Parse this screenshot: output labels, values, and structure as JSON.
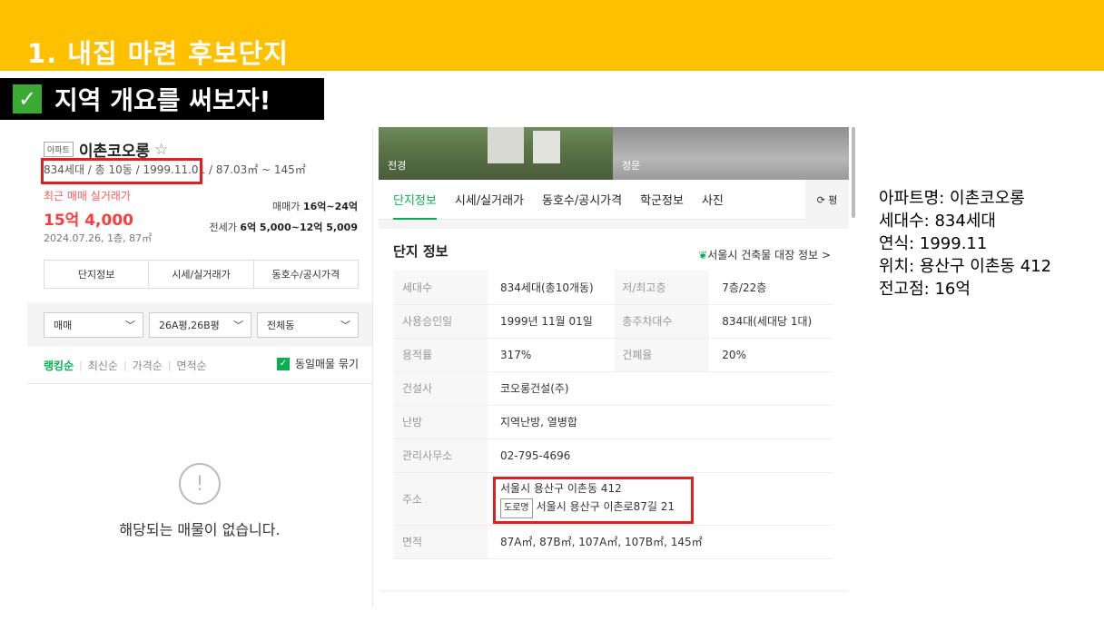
{
  "banner": {
    "title": "1. 내집 마련 후보단지"
  },
  "subtitle": {
    "text": "지역 개요를 써보자!"
  },
  "left": {
    "type_tag": "아파트",
    "name": "이촌코오롱",
    "summary": "834세대 / 총 10동 / 1999.11.01 / 87.03㎡ ~ 145㎡",
    "recent_label": "최근 매매 실거래가",
    "recent_price": "15억 4,000",
    "recent_date": "2024.07.26, 1층, 87㎡",
    "sale_label": "매매가",
    "sale_range": "16억~24억",
    "jeonse_label": "전세가",
    "jeonse_range": "6억 5,000~12억 5,009",
    "tabs": [
      "단지정보",
      "시세/실거래가",
      "동호수/공시가격"
    ],
    "filters": [
      "매매",
      "26A평,26B평",
      "전체동"
    ],
    "sort": [
      "랭킹순",
      "최신순",
      "가격순",
      "면적순"
    ],
    "same_group": "동일매물 묶기",
    "empty_text": "해당되는 매물이 없습니다."
  },
  "middle": {
    "photo_captions": [
      "전경",
      "정문"
    ],
    "tabs": [
      "단지정보",
      "시세/실거래가",
      "동호수/공시가격",
      "학군정보",
      "사진"
    ],
    "refresh_label": "평",
    "info_title": "단지 정보",
    "info_link": "서울시 건축물 대장 정보 >",
    "rows": {
      "households_k": "세대수",
      "households_v": "834세대(총10개동)",
      "floors_k": "저/최고층",
      "floors_v": "7층/22층",
      "approval_k": "사용승인일",
      "approval_v": "1999년 11월 01일",
      "parking_k": "총주차대수",
      "parking_v": "834대(세대당 1대)",
      "far_k": "용적률",
      "far_v": "317%",
      "bcr_k": "건폐율",
      "bcr_v": "20%",
      "builder_k": "건설사",
      "builder_v": "코오롱건설(주)",
      "heating_k": "난방",
      "heating_v": "지역난방, 열병합",
      "office_k": "관리사무소",
      "office_v": "02-795-4696",
      "address_k": "주소",
      "address_v": "서울시 용산구 이촌동 412",
      "road_tag": "도로명",
      "road_v": "서울시 용산구 이촌로87길 21",
      "area_k": "면적",
      "area_v": "87A㎡, 87B㎡, 107A㎡, 107B㎡, 145㎡"
    }
  },
  "notes": [
    "아파트명: 이촌코오롱",
    "세대수: 834세대",
    "연식: 1999.11",
    "위치: 용산구 이촌동 412",
    "전고점: 16억"
  ]
}
